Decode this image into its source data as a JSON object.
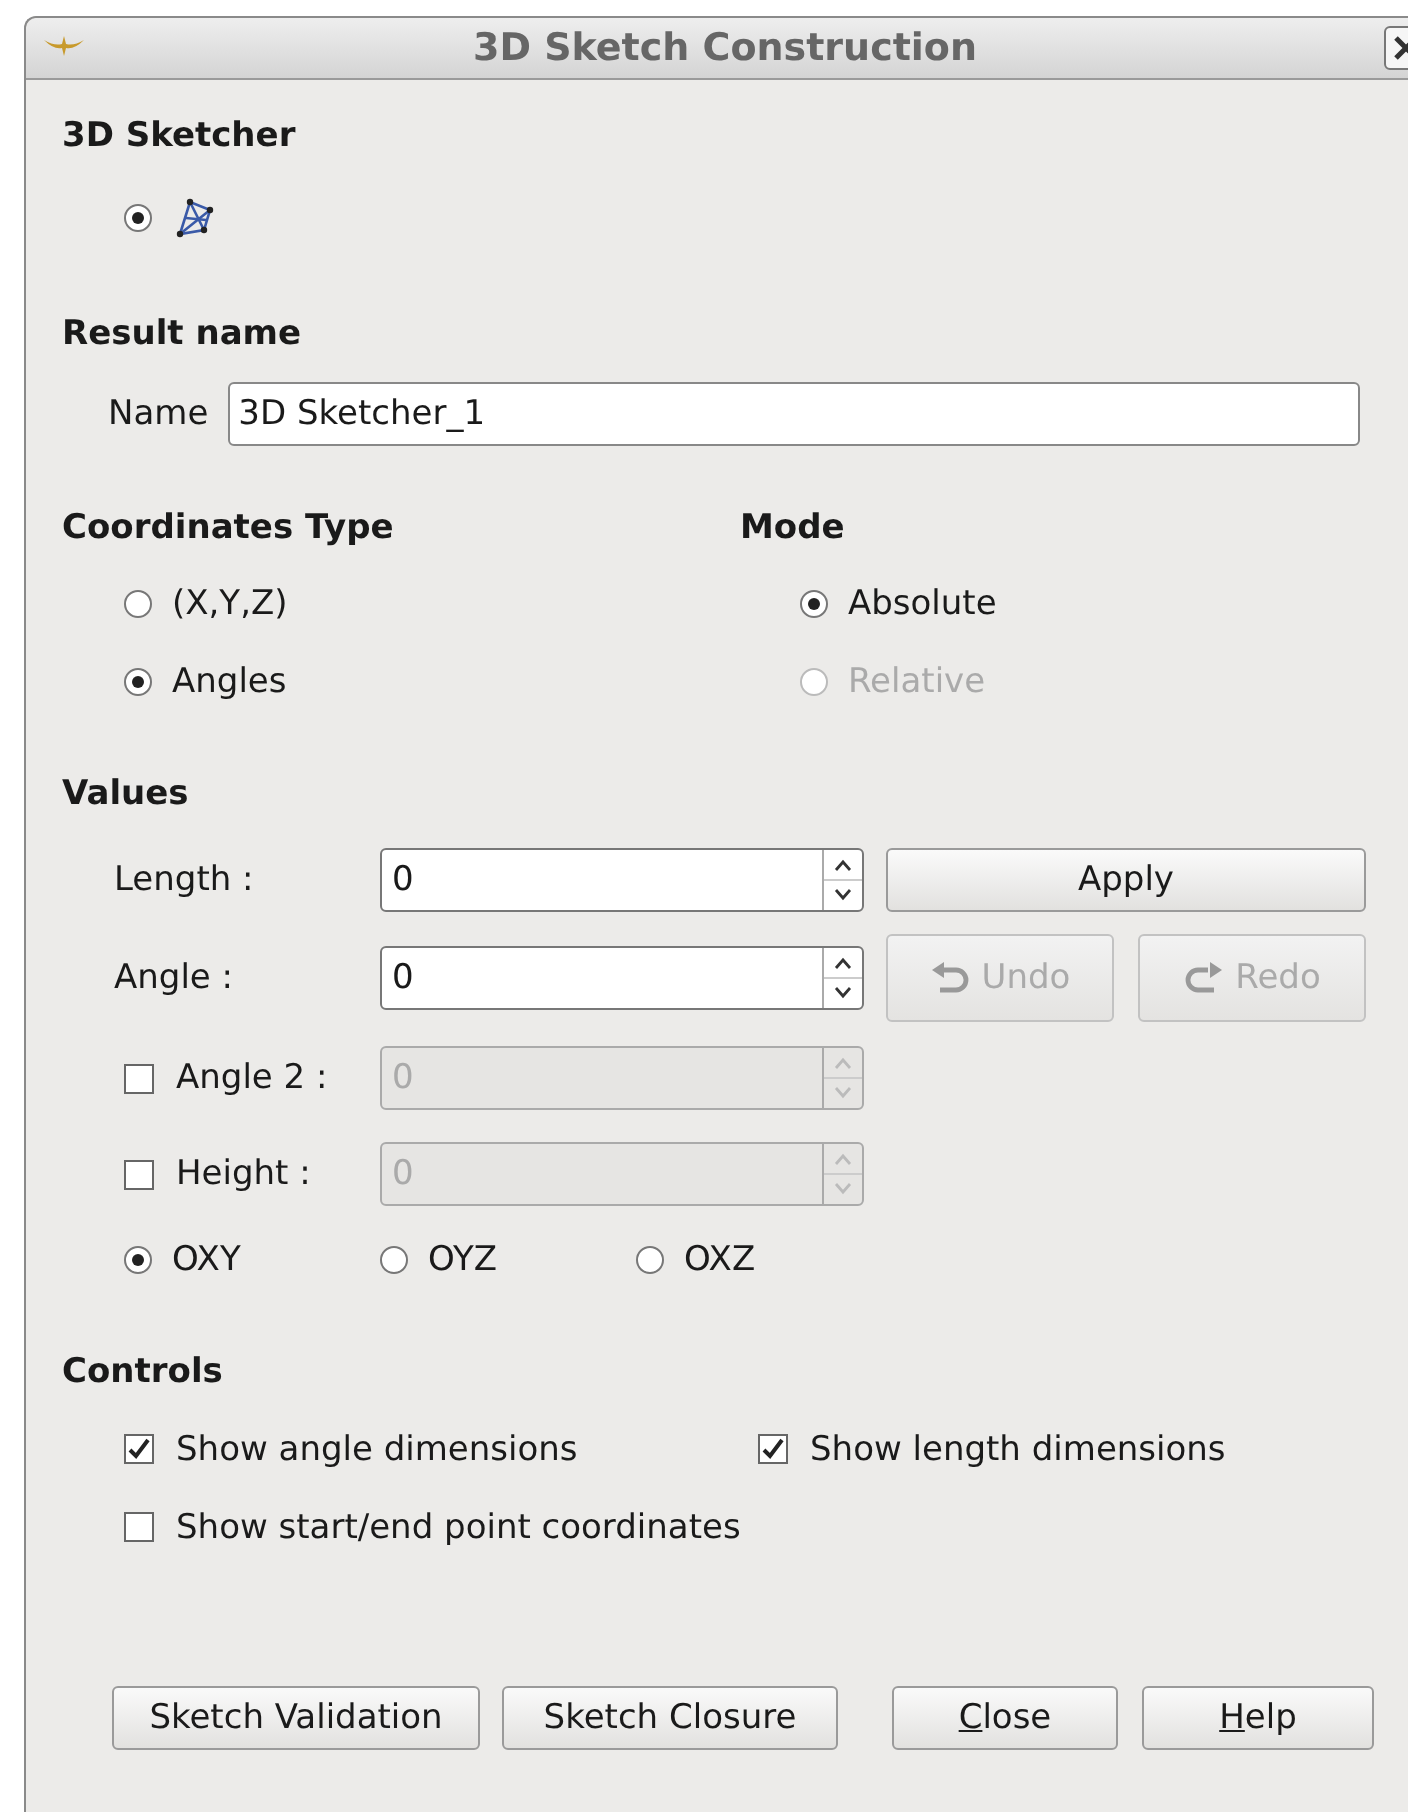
{
  "window": {
    "title": "3D Sketch Construction"
  },
  "sketcher": {
    "heading": "3D Sketcher",
    "options": [
      {
        "selected": true
      }
    ]
  },
  "result": {
    "heading": "Result name",
    "name_label": "Name",
    "name_value": "3D Sketcher_1"
  },
  "coordinates_type": {
    "heading": "Coordinates Type",
    "options": [
      {
        "label": "(X,Y,Z)",
        "selected": false,
        "disabled": false
      },
      {
        "label": "Angles",
        "selected": true,
        "disabled": false
      }
    ]
  },
  "mode": {
    "heading": "Mode",
    "options": [
      {
        "label": "Absolute",
        "selected": true,
        "disabled": false
      },
      {
        "label": "Relative",
        "selected": false,
        "disabled": true
      }
    ]
  },
  "values": {
    "heading": "Values",
    "fields": [
      {
        "kind": "plain",
        "label": "Length :",
        "value": "0",
        "disabled": false
      },
      {
        "kind": "plain",
        "label": "Angle :",
        "value": "0",
        "disabled": false
      },
      {
        "kind": "checkbox",
        "label": "Angle 2 :",
        "value": "0",
        "checked": false,
        "disabled": true
      },
      {
        "kind": "checkbox",
        "label": "Height :",
        "value": "0",
        "checked": false,
        "disabled": true
      }
    ],
    "apply": {
      "label": "Apply",
      "disabled": false
    },
    "undo": {
      "label": "Undo",
      "disabled": true
    },
    "redo": {
      "label": "Redo",
      "disabled": true
    },
    "planes": [
      {
        "label": "OXY",
        "selected": true
      },
      {
        "label": "OYZ",
        "selected": false
      },
      {
        "label": "OXZ",
        "selected": false
      }
    ]
  },
  "controls": {
    "heading": "Controls",
    "options": [
      {
        "label": "Show angle dimensions",
        "checked": true
      },
      {
        "label": "Show length dimensions",
        "checked": true
      },
      {
        "label": "Show start/end point coordinates",
        "checked": false
      }
    ]
  },
  "buttons": [
    {
      "label": "Sketch Validation",
      "mnemonic": false
    },
    {
      "label": "Sketch Closure",
      "mnemonic": false
    },
    {
      "label": "Close",
      "mnemonic": true
    },
    {
      "label": "Help",
      "mnemonic": true
    }
  ]
}
